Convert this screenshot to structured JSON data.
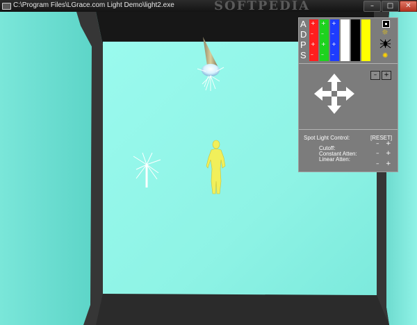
{
  "window": {
    "title": "C:\\Program Files\\LGrace.com Light Demo\\light2.exe",
    "watermark": "SOFTPEDIA",
    "minimize_label": "–",
    "maximize_label": "□",
    "close_label": "✕"
  },
  "scene": {
    "background_color": "#171717",
    "wall_color_light": "#a2fbf1",
    "wall_color_dark": "#5ce3d4",
    "figure_color": "#f1ef5a",
    "cone_color": "#c4b98a"
  },
  "panel": {
    "row_labels": [
      "A",
      "D",
      "P",
      "S"
    ],
    "swatch_colors": [
      "#ff1e1e",
      "#1ed21e",
      "#1e3cff",
      "#ffffff",
      "#000000",
      "#ffff00"
    ],
    "light_icons": [
      "square-light-icon",
      "sun-light-icon",
      "spider-light-icon",
      "bulb-light-icon"
    ],
    "zoom_minus": "–",
    "zoom_plus": "+",
    "spot_light_label": "Spot Light Control:",
    "reset_label": "[RESET]",
    "cutoff_label": "Cutoff:",
    "constant_atten_label": "Constant Atten:",
    "linear_atten_label": "Linear Atten:",
    "minus": "–",
    "plus": "+"
  }
}
